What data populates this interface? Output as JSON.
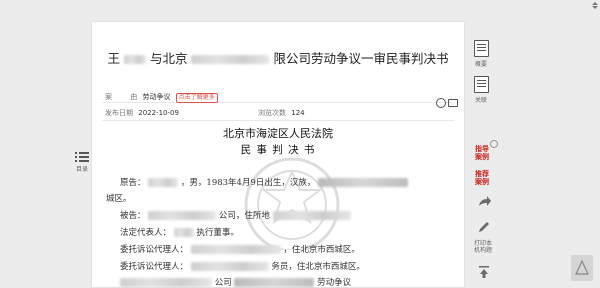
{
  "document": {
    "title_start": "王",
    "title_mid": "与北京",
    "title_end": "限公司劳动争议一审民事判决书",
    "case_label": "案",
    "case_mid": "由",
    "case_value": "劳动争议",
    "tag": "点击了解更多",
    "publish_label": "发布日期",
    "publish_date": "2022-10-09",
    "views_label": "浏览次数",
    "views_count": "124",
    "court_name": "北京市海淀区人民法院",
    "doc_type": "民 事 判 决 书",
    "para1_start": "原告：",
    "para1_mid": "，男，1983年4月9日出生，汉族，",
    "para1_cont": "城区。",
    "para2_start": "被告：",
    "para2_mid": "公司，住所地",
    "para3_start": "法定代表人：",
    "para3_end": "执行董事。",
    "para4_start": "委托诉讼代理人：",
    "para4_end": "，住北京市西城区。",
    "para5_start": "委托诉讼代理人：",
    "para5_end": "务员，住北京市西城区。",
    "para6_mid": "公司",
    "para6_end": "劳动争议"
  },
  "left_toolbar": {
    "toc_label": "目录"
  },
  "right_toolbar": {
    "summary_label": "概要",
    "related_label": "关联",
    "guide_label": "指导\n案例",
    "recommend_label": "推荐\n案例",
    "print_label": "打印本\n机构题"
  },
  "icons": {
    "toc": "list-icon",
    "summary": "document-icon",
    "related": "document-icon",
    "share": "share-icon",
    "edit": "pencil-icon",
    "print": "printer-icon",
    "top": "arrow-up-icon",
    "corner": "triangle-icon",
    "scroll": "scroll-arrows-icon"
  }
}
